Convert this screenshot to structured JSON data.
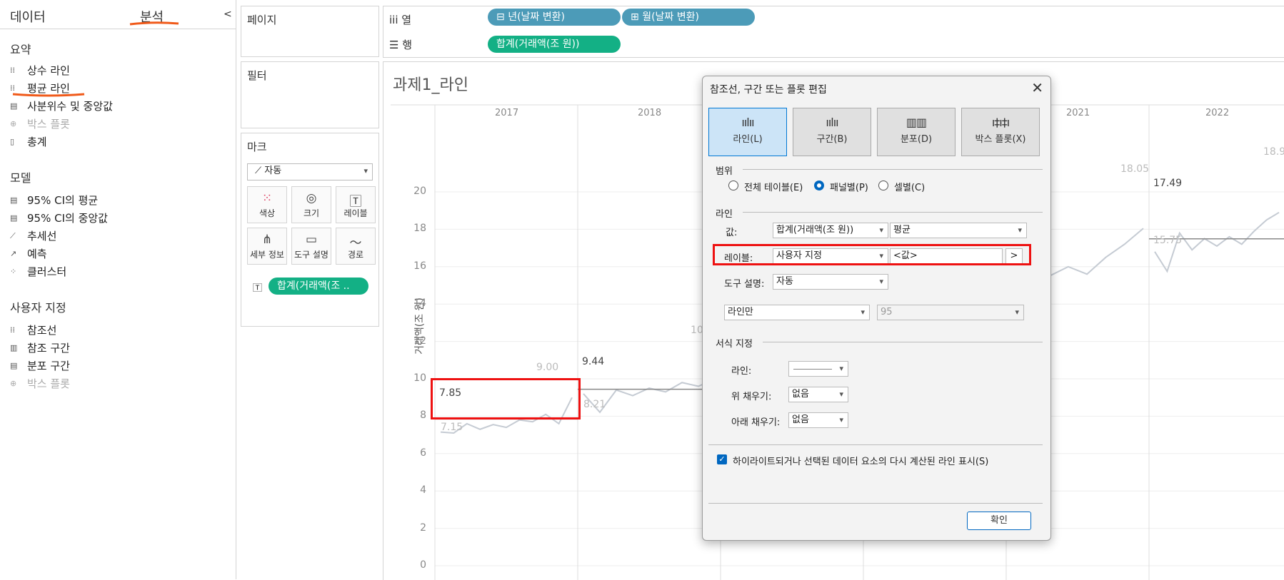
{
  "sidebar": {
    "tab_data": "데이터",
    "tab_analysis": "분석",
    "collapse": "<",
    "summary": {
      "title": "요약",
      "items": [
        {
          "label": "상수 라인",
          "icon": "reference-line-icon",
          "enabled": true
        },
        {
          "label": "평균 라인",
          "icon": "average-line-icon",
          "enabled": true
        },
        {
          "label": "사분위수 및 중앙값",
          "icon": "quartile-icon",
          "enabled": true
        },
        {
          "label": "박스 플롯",
          "icon": "box-plot-icon",
          "enabled": false
        },
        {
          "label": "총계",
          "icon": "totals-icon",
          "enabled": true
        }
      ]
    },
    "model": {
      "title": "모델",
      "items": [
        {
          "label": "95% CI의 평균",
          "icon": "ci-icon"
        },
        {
          "label": "95% CI의 중앙값",
          "icon": "ci-icon"
        },
        {
          "label": "추세선",
          "icon": "trend-icon"
        },
        {
          "label": "예측",
          "icon": "forecast-icon"
        },
        {
          "label": "클러스터",
          "icon": "cluster-icon"
        }
      ]
    },
    "custom": {
      "title": "사용자 지정",
      "items": [
        {
          "label": "참조선",
          "icon": "reference-line-icon",
          "enabled": true
        },
        {
          "label": "참조 구간",
          "icon": "band-icon",
          "enabled": true
        },
        {
          "label": "분포 구간",
          "icon": "distribution-icon",
          "enabled": true
        },
        {
          "label": "박스 플롯",
          "icon": "box-plot-icon",
          "enabled": false
        }
      ]
    }
  },
  "panels": {
    "pages": "페이지",
    "filters": "필터",
    "marks": "마크",
    "mark_type": "자동",
    "mark_buttons": [
      "색상",
      "크기",
      "레이블",
      "세부 정보",
      "도구 설명",
      "경로"
    ],
    "mark_pill": "합계(거래액(조 .."
  },
  "shelves": {
    "columns_label": "열",
    "rows_label": "행",
    "columns_pills": [
      "년(날짜 변환)",
      "월(날짜 변환)"
    ],
    "rows_pill": "합계(거래액(조 원))"
  },
  "view": {
    "title": "과제1_라인",
    "y_axis_label": "거래액(조 원)",
    "y_ticks": [
      "20",
      "18",
      "16",
      "14",
      "12",
      "10",
      "8",
      "6",
      "4",
      "2",
      "0"
    ],
    "years": [
      "2017",
      "2018",
      "2021",
      "2022"
    ],
    "ref_labels": [
      {
        "text": "7.85"
      },
      {
        "text": "9.44"
      },
      {
        "text": "17.49"
      }
    ],
    "value_labels": [
      "7.15",
      "9.00",
      "8.21",
      "10",
      "18.05",
      "15.75",
      "18.9"
    ]
  },
  "chart_data": {
    "type": "line",
    "title": "과제1_라인",
    "ylabel": "거래액(조 원)",
    "ylim": [
      0,
      20
    ],
    "panels": [
      {
        "year": "2017",
        "average": 7.85,
        "values": [
          7.15,
          7.1,
          7.6,
          7.3,
          7.55,
          7.4,
          7.8,
          7.7,
          8.1,
          7.6,
          9.0
        ]
      },
      {
        "year": "2018",
        "average": 9.44,
        "values": [
          9.2,
          8.21,
          9.4,
          9.1,
          9.5,
          9.3,
          9.8,
          9.6,
          10.0
        ]
      },
      {
        "year": "2021",
        "average": null,
        "values": [
          15.2,
          15.8,
          15.5,
          16.0,
          15.6,
          16.5,
          17.2,
          18.05
        ]
      },
      {
        "year": "2022",
        "average": 17.49,
        "values": [
          16.8,
          15.75,
          17.8,
          16.9,
          17.5,
          17.1,
          17.6,
          17.2,
          17.9,
          18.5,
          18.9
        ]
      }
    ]
  },
  "dialog": {
    "title": "참조선, 구간 또는 플롯 편집",
    "tabs": [
      "라인(L)",
      "구간(B)",
      "분포(D)",
      "박스 플롯(X)"
    ],
    "scope_title": "범위",
    "scope_options": [
      "전체 테이블(E)",
      "패널별(P)",
      "셀별(C)"
    ],
    "line_title": "라인",
    "value_label": "값:",
    "value_field": "합계(거래액(조 원))",
    "value_agg": "평균",
    "label_label": "레이블:",
    "label_value": "사용자 지정",
    "label_text": "<값>",
    "label_btn": ">",
    "tooltip_label": "도구 설명:",
    "tooltip_value": "자동",
    "line_only": "라인만",
    "ci_value": "95",
    "format_title": "서식 지정",
    "format_line": "라인:",
    "fill_above": "위 채우기:",
    "fill_above_value": "없음",
    "fill_below": "아래 채우기:",
    "fill_below_value": "없음",
    "checkbox_label": "하이라이트되거나 선택된 데이터 요소의 다시 계산된 라인 표시(S)",
    "ok": "확인"
  },
  "colors": {
    "pill_blue": "#4c9bb8",
    "pill_green": "#13b085",
    "annotation_red": "#e11111",
    "annotation_orange": "#f05a1a",
    "dialog_accent": "#0067c0"
  }
}
